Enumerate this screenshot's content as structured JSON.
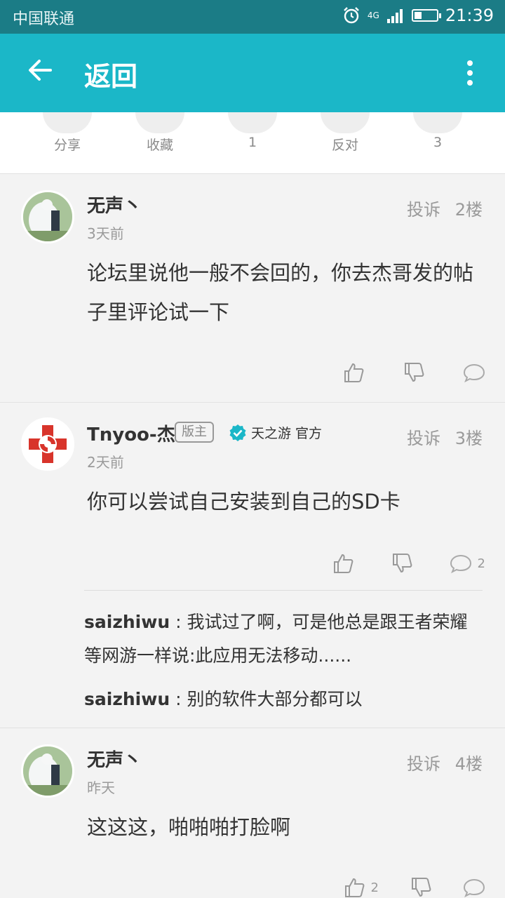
{
  "status": {
    "carrier": "中国联通",
    "time": "21:39",
    "network": "4G"
  },
  "header": {
    "title": "返回"
  },
  "actions": [
    {
      "label": "分享",
      "icon": "share-icon"
    },
    {
      "label": "收藏",
      "icon": "favorite-icon"
    },
    {
      "label": "1",
      "icon": "like-icon"
    },
    {
      "label": "反对",
      "icon": "oppose-icon"
    },
    {
      "label": "3",
      "icon": "comment-icon"
    }
  ],
  "posts": [
    {
      "user": "无声丶",
      "time": "3天前",
      "report": "投诉",
      "floor": "2楼",
      "content": "论坛里说他一般不会回的，你去杰哥发的帖子里评论试一下"
    },
    {
      "user": "Tnyoo-杰",
      "badge": "版主",
      "verified": "天之游 官方",
      "time": "2天前",
      "report": "投诉",
      "floor": "3楼",
      "content": "你可以尝试自己安装到自己的SD卡",
      "comment_count": "2",
      "replies": [
        {
          "user": "saizhiwu",
          "sep": " : ",
          "text": "我试过了啊，可是他总是跟王者荣耀等网游一样说:此应用无法移动......"
        },
        {
          "user": "saizhiwu",
          "sep": " : ",
          "text": "别的软件大部分都可以"
        }
      ]
    },
    {
      "user": "无声丶",
      "time": "昨天",
      "report": "投诉",
      "floor": "4楼",
      "content": "这这这，啪啪啪打脸啊",
      "like_count": "2"
    }
  ],
  "colors": {
    "appbar": "#1bb7c8",
    "statusbar": "#1b7c86",
    "verified": "#1bb7c8"
  }
}
